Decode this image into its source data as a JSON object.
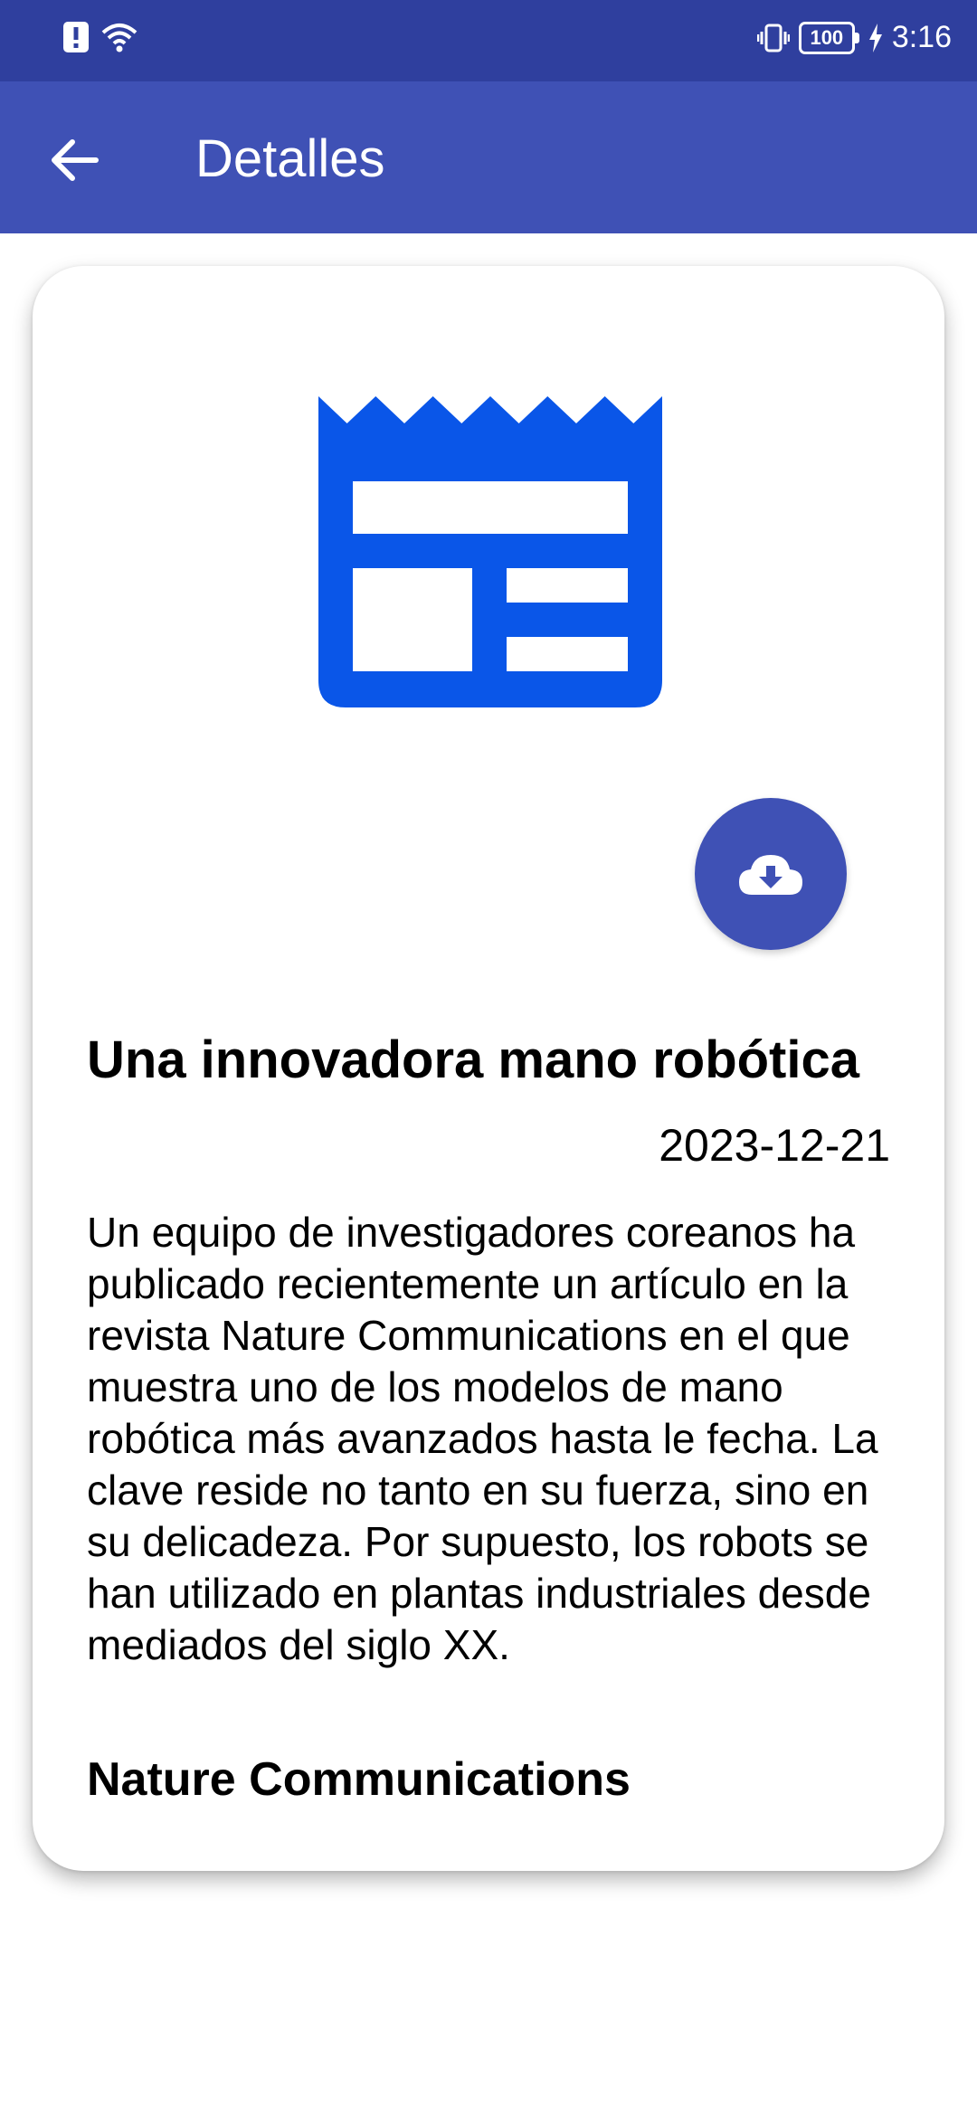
{
  "status_bar": {
    "time": "3:16",
    "battery_level": "100",
    "icons": [
      "alert-icon",
      "wifi-icon",
      "vibrate-icon",
      "battery-icon",
      "charging-icon"
    ]
  },
  "app_bar": {
    "title": "Detalles",
    "back_icon": "arrow-back-icon",
    "background_color": "#3f51b5"
  },
  "article": {
    "icon": "newspaper-icon",
    "icon_color": "#0a56e8",
    "download_icon": "cloud-download-icon",
    "title": "Una innovadora mano robótica",
    "date": "2023-12-21",
    "body": "Un equipo de investigadores coreanos ha publicado recientemente un artículo en la revista Nature Communications en el que muestra uno de los modelos de mano robótica más avanzados hasta le fecha. La clave reside no tanto en su fuerza, sino en su delicadeza. Por supuesto, los robots se han utilizado en plantas industriales desde mediados del siglo XX.",
    "source": "Nature Communications"
  }
}
